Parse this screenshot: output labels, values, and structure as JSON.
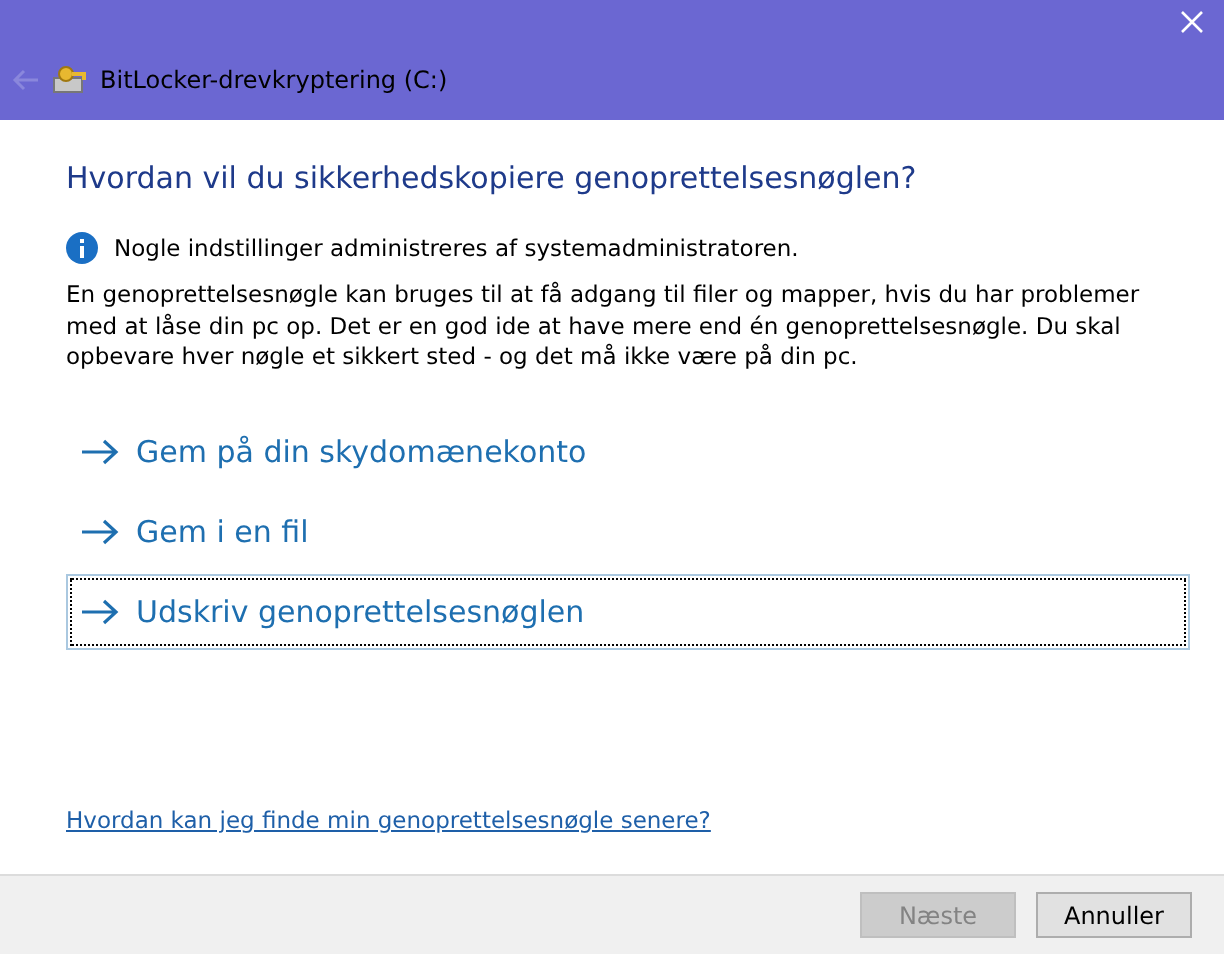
{
  "window": {
    "title": "BitLocker-drevkryptering (C:)"
  },
  "heading": "Hvordan vil du sikkerhedskopiere genoprettelsesnøglen?",
  "info": "Nogle indstillinger administreres af systemadministratoren.",
  "description": "En genoprettelsesnøgle kan bruges til at få adgang til filer og mapper, hvis du har problemer med at låse din pc op. Det er en god ide at have mere end én genoprettelsesnøgle. Du skal opbevare hver nøgle et sikkert sted - og det må ikke være på din pc.",
  "options": [
    {
      "label": "Gem på din skydomænekonto",
      "focused": false
    },
    {
      "label": "Gem i en fil",
      "focused": false
    },
    {
      "label": "Udskriv genoprettelsesnøglen",
      "focused": true
    }
  ],
  "help_link": "Hvordan kan jeg finde min genoprettelsesnøgle senere?",
  "buttons": [
    {
      "label": "Næste",
      "disabled": true
    },
    {
      "label": "Annuller",
      "disabled": false
    }
  ]
}
